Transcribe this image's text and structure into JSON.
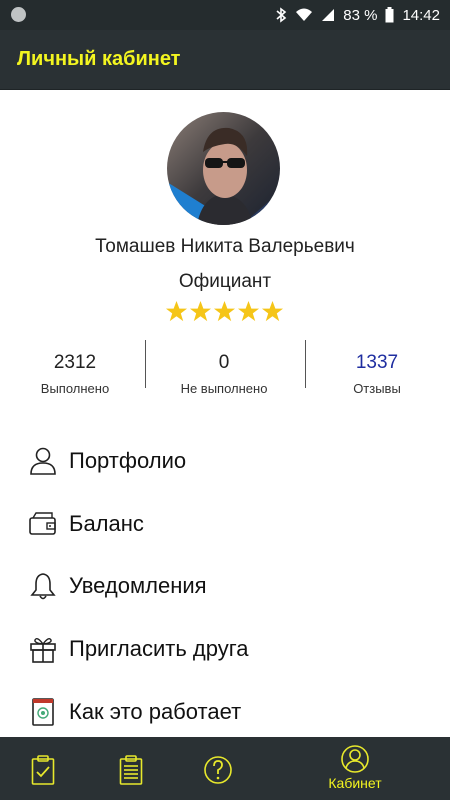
{
  "status_bar": {
    "battery": "83 %",
    "time": "14:42",
    "icons": [
      "notification-dot-icon",
      "bluetooth-icon",
      "wifi-icon",
      "signal-icon",
      "battery-icon"
    ]
  },
  "app_bar": {
    "title": "Личный кабинет",
    "title_color": "#f3f520",
    "background": "#2a3134"
  },
  "profile": {
    "name": "Томашев Никита Валерьевич",
    "role": "Официант",
    "rating_stars": 5,
    "rating_max": 5
  },
  "stats": [
    {
      "value": "2312",
      "label": "Выполнено"
    },
    {
      "value": "0",
      "label": "Не выполнено"
    },
    {
      "value": "1337",
      "label": "Отзывы"
    }
  ],
  "menu": [
    {
      "label": "Портфолио",
      "icon": "user-icon"
    },
    {
      "label": "Баланс",
      "icon": "wallet-icon"
    },
    {
      "label": "Уведомления",
      "icon": "bell-icon"
    },
    {
      "label": "Пригласить друга",
      "icon": "gift-icon"
    },
    {
      "label": "Как это работает",
      "icon": "info-book-icon"
    }
  ],
  "bottom_nav": {
    "items": [
      {
        "icon": "clipboard-check-icon",
        "label": ""
      },
      {
        "icon": "clipboard-list-icon",
        "label": ""
      },
      {
        "icon": "help-icon",
        "label": ""
      },
      {
        "icon": "profile-icon",
        "label": "Кабинет",
        "active": true
      }
    ],
    "accent": "#f3f520"
  }
}
